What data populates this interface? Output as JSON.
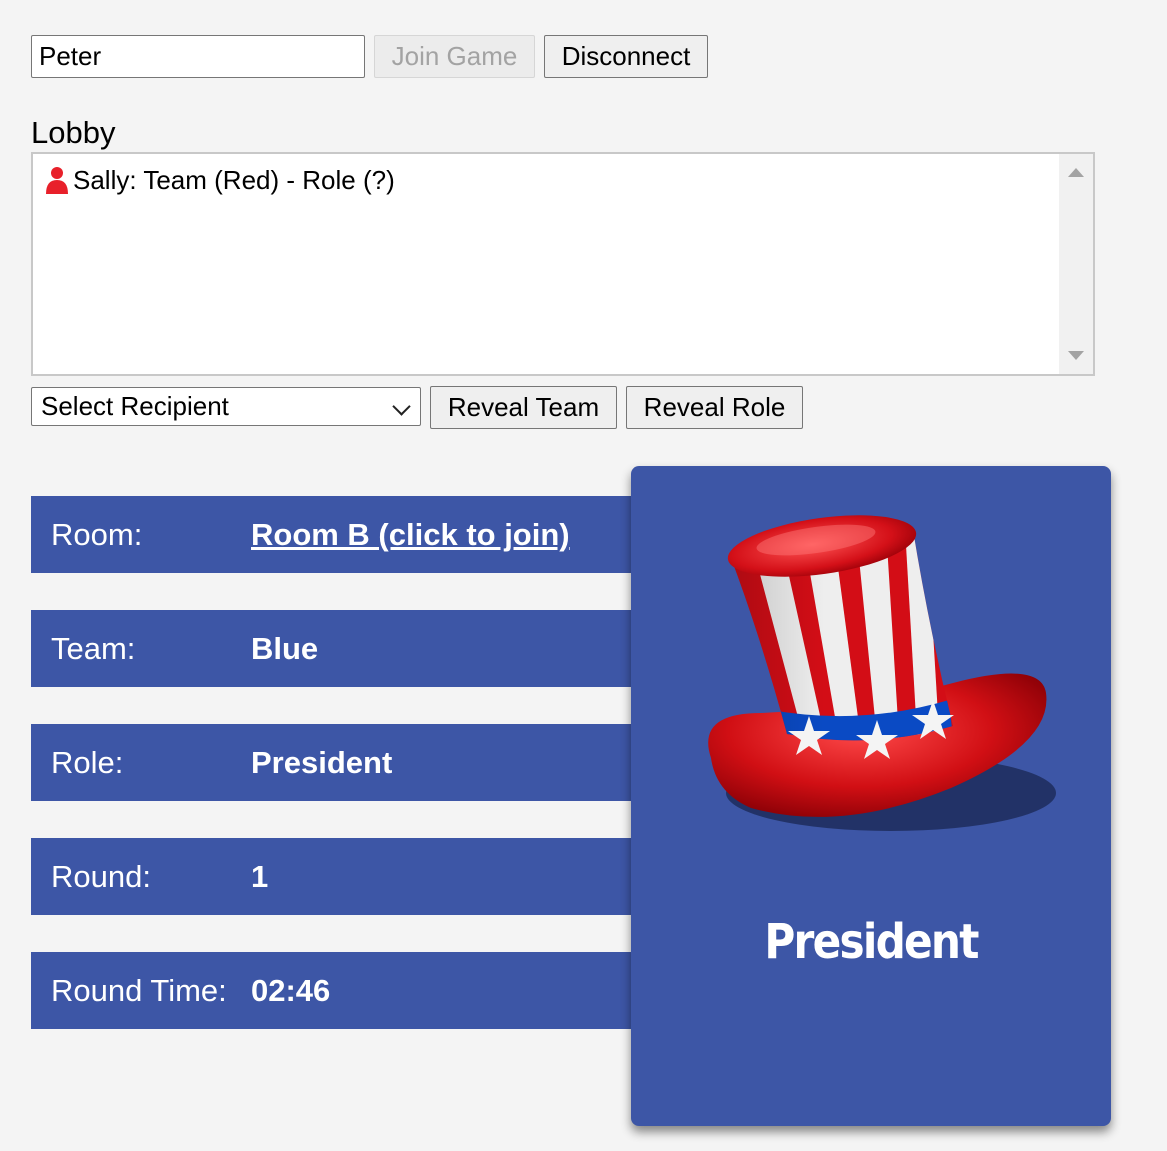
{
  "top_bar": {
    "name_value": "Peter",
    "join_label": "Join Game",
    "disconnect_label": "Disconnect"
  },
  "lobby": {
    "label": "Lobby",
    "entries": [
      {
        "text": "Sally: Team (Red) - Role (?)",
        "icon": "person-icon",
        "icon_color": "#e8202a"
      }
    ]
  },
  "controls": {
    "recipient_selected": "Select Recipient",
    "reveal_team_label": "Reveal Team",
    "reveal_role_label": "Reveal Role"
  },
  "info": {
    "room_label": "Room:",
    "room_value": "Room B (click to join)",
    "team_label": "Team:",
    "team_value": "Blue",
    "role_label": "Role:",
    "role_value": "President",
    "round_label": "Round:",
    "round_value": "1",
    "round_time_label": "Round Time:",
    "round_time_value": "02:46"
  },
  "card": {
    "title": "President",
    "image": "uncle-sam-hat",
    "background": "#3d56a6"
  },
  "colors": {
    "bar_blue": "#3d56a6",
    "page_bg": "#f4f4f4"
  }
}
